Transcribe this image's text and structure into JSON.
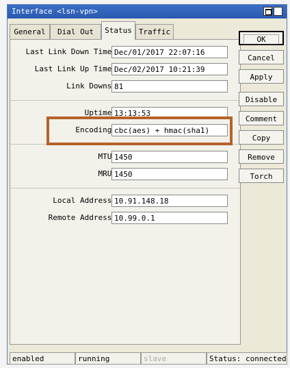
{
  "window": {
    "title": "Interface <lsn-vpn>",
    "maximize_icon": "maximize-icon",
    "close_icon": "close-icon",
    "close_glyph": "✕"
  },
  "tabs": [
    {
      "label": "General"
    },
    {
      "label": "Dial Out"
    },
    {
      "label": "Status",
      "active": true
    },
    {
      "label": "Traffic"
    }
  ],
  "status_fields": {
    "last_link_down_time": {
      "label": "Last Link Down Time:",
      "value": "Dec/01/2017 22:07:16"
    },
    "last_link_up_time": {
      "label": "Last Link Up Time:",
      "value": "Dec/02/2017 10:21:39"
    },
    "link_downs": {
      "label": "Link Downs:",
      "value": "81"
    },
    "uptime": {
      "label": "Uptime:",
      "value": "13:13:53"
    },
    "encoding": {
      "label": "Encoding:",
      "value": "cbc(aes) + hmac(sha1)"
    },
    "mtu": {
      "label": "MTU:",
      "value": "1450"
    },
    "mru": {
      "label": "MRU:",
      "value": "1450"
    },
    "local_address": {
      "label": "Local Address:",
      "value": "10.91.148.18"
    },
    "remote_address": {
      "label": "Remote Address:",
      "value": "10.99.0.1"
    }
  },
  "buttons": {
    "ok": "OK",
    "cancel": "Cancel",
    "apply": "Apply",
    "disable": "Disable",
    "comment": "Comment",
    "copy": "Copy",
    "remove": "Remove",
    "torch": "Torch"
  },
  "status_bar": {
    "enabled": "enabled",
    "running": "running",
    "slave": "slave",
    "status": "Status: connected"
  },
  "colors": {
    "highlight_box": "#b5622b",
    "titlebar": "#3a6fc6"
  }
}
